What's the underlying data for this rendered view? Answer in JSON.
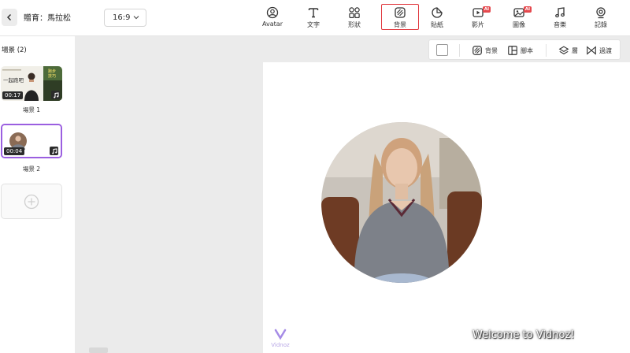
{
  "header": {
    "back_label": "<",
    "project_title": "贈育：馬拉松",
    "ratio": "16:9"
  },
  "toolbar": {
    "tools": [
      {
        "label": "Avatar",
        "icon": "avatar-icon"
      },
      {
        "label": "文字",
        "icon": "text-icon"
      },
      {
        "label": "形狀",
        "icon": "shapes-icon"
      },
      {
        "label": "背景",
        "icon": "background-icon",
        "active": true
      },
      {
        "label": "貼紙",
        "icon": "sticker-icon"
      },
      {
        "label": "影片",
        "icon": "video-icon",
        "badge": "AI"
      },
      {
        "label": "圖像",
        "icon": "image-icon",
        "badge": "AI"
      },
      {
        "label": "音樂",
        "icon": "music-icon"
      },
      {
        "label": "記錄",
        "icon": "record-icon"
      }
    ]
  },
  "sidebar": {
    "scene_count": "場景 (2)",
    "scenes": [
      {
        "label": "場景 1",
        "duration": "00:17",
        "thumb_text_left": "一起跑吧",
        "thumb_text_right": "跑步 技巧"
      },
      {
        "label": "場景 2",
        "duration": "00:04"
      }
    ],
    "add_label": "+"
  },
  "canvas_toolbar": {
    "background_label": "背景",
    "script_label": "腳本",
    "layer_label": "層",
    "transition_label": "過渡"
  },
  "canvas": {
    "welcome_text": "Welcome to Vidnoz!",
    "watermark_text": "Vidnoz"
  },
  "colors": {
    "accent": "#e0383e",
    "selection": "#9b5fe0"
  }
}
